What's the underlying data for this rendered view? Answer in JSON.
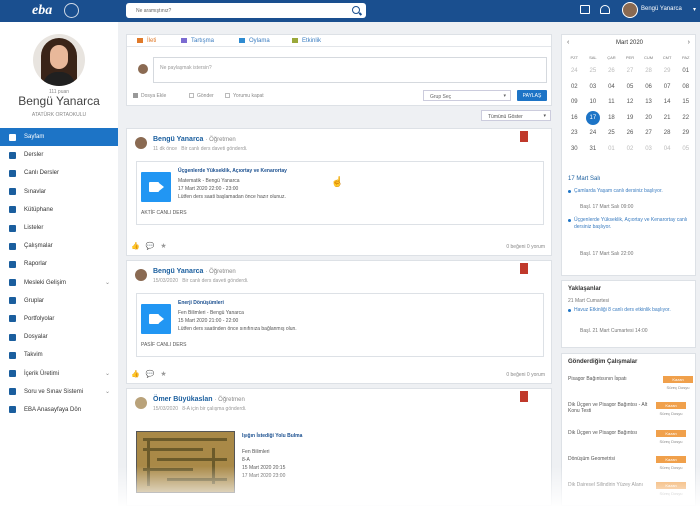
{
  "header": {
    "logo": "eba",
    "search_placeholder": "Ne aramıştınız?",
    "user_name": "Bengü Yanarca"
  },
  "profile": {
    "points": "111 puan",
    "name": "Bengü Yanarca",
    "school": "ATATÜRK ORTAOKULU"
  },
  "nav": [
    {
      "label": "Sayfam",
      "icon": "home-icon"
    },
    {
      "label": "Dersler",
      "icon": "gear-icon"
    },
    {
      "label": "Canlı Dersler",
      "icon": "video-icon"
    },
    {
      "label": "Sınavlar",
      "icon": "pencil-icon"
    },
    {
      "label": "Kütüphane",
      "icon": "book-icon"
    },
    {
      "label": "Listeler",
      "icon": "list-icon"
    },
    {
      "label": "Çalışmalar",
      "icon": "users-icon"
    },
    {
      "label": "Raporlar",
      "icon": "chart-icon"
    },
    {
      "label": "Mesleki Gelişim",
      "icon": "graduation-icon",
      "caret": true
    },
    {
      "label": "Gruplar",
      "icon": "group-icon"
    },
    {
      "label": "Portfolyolar",
      "icon": "folder-icon"
    },
    {
      "label": "Dosyalar",
      "icon": "file-icon"
    },
    {
      "label": "Takvim",
      "icon": "calendar-icon"
    },
    {
      "label": "İçerik Üretimi",
      "icon": "content-icon",
      "caret": true
    },
    {
      "label": "Soru ve Sınav Sistemi",
      "icon": "question-icon",
      "caret": true
    },
    {
      "label": "EBA Anasayfaya Dön",
      "icon": "back-icon"
    }
  ],
  "composer": {
    "tabs": [
      "İleti",
      "Tartışma",
      "Oylama",
      "Etkinlik"
    ],
    "placeholder": "Ne paylaşmak istersin?",
    "options": [
      "Dosya Ekle",
      "Gönder",
      "Yorumu kapat"
    ],
    "group_select": "Grup Seç",
    "share_button": "PAYLAŞ"
  },
  "filter": "Tümünü Göster",
  "posts": [
    {
      "name": "Bengü Yanarca",
      "role": "· Öğretmen",
      "time": "11 dk önce",
      "action": "Bir canlı ders daveti gönderdi.",
      "card_title": "Üçgenlerde Yükseklik, Açıortay ve Kenarortay",
      "lines": [
        "Matematik - Bengü Yanarca",
        "17 Mart 2020 22:00 - 23:00",
        "Lütfen ders saati başlamadan önce hazır olunuz."
      ],
      "status": "AKTİF CANLI DERS",
      "stats": "0 beğeni   0 yorum"
    },
    {
      "name": "Bengü Yanarca",
      "role": "· Öğretmen",
      "time": "15/03/2020",
      "action": "Bir canlı ders daveti gönderdi.",
      "card_title": "Enerji Dönüşümleri",
      "lines": [
        "Fen Bilimleri - Bengü Yanarca",
        "15 Mart 2020 21:00 - 22:00",
        "Lütfen ders saatinden önce sınıfınıza bağlanmış olun."
      ],
      "status": "PASİF CANLI DERS",
      "stats": "0 beğeni   0 yorum"
    },
    {
      "name": "Ömer Büyükaslan",
      "role": "· Öğretmen",
      "time": "15/03/2020",
      "action": "8-A için bir çalışma gönderdi.",
      "card_title": "Işığın İstediği Yolu Bulma",
      "lines": [
        "Fen Bilimleri",
        "8-A",
        "15 Mart 2020 20:15",
        "17 Mart 2020 23:00"
      ]
    }
  ],
  "calendar": {
    "month": "Mart 2020",
    "days_of_week": [
      "PZT",
      "SAL",
      "ÇAR",
      "PER",
      "CUM",
      "CMT",
      "PAZ"
    ],
    "weeks": [
      [
        "24",
        "25",
        "26",
        "27",
        "28",
        "29",
        "01"
      ],
      [
        "02",
        "03",
        "04",
        "05",
        "06",
        "07",
        "08"
      ],
      [
        "09",
        "10",
        "11",
        "12",
        "13",
        "14",
        "15"
      ],
      [
        "16",
        "17",
        "18",
        "19",
        "20",
        "21",
        "22"
      ],
      [
        "23",
        "24",
        "25",
        "26",
        "27",
        "28",
        "29"
      ],
      [
        "30",
        "31",
        "01",
        "02",
        "03",
        "04",
        "05"
      ]
    ],
    "selected_date": "17 Mart Salı",
    "events": [
      {
        "title": "Çamlarda Yaşam canlı dersiniz başlıyor.",
        "time": "Başl. 17 Mart Salı 09:00"
      },
      {
        "title": "Üçgenlerde Yükseklik, Açıortay ve Kenarortay canlı dersiniz başlıyor.",
        "time": "Başl. 17 Mart Salı 22:00"
      }
    ],
    "upcoming_title": "Yaklaşanlar",
    "upcoming_date": "21 Mart Cumartesi",
    "upcoming_event": {
      "title": "Havuz Etkinliği 8 canlı ders etkinlik başlıyor.",
      "time": "Başl. 21 Mart Cumartesi 14:00"
    }
  },
  "sent_works": {
    "title": "Gönderdiğim Çalışmalar",
    "items": [
      {
        "title": "Pisagor Bağıntısının İspatı",
        "badge": "Kazan",
        "link": "Süreç Dosyu"
      },
      {
        "title": "Dik Üçgen ve Pisagor Bağıntısı - Alt Konu Testi",
        "badge": "Kazan",
        "link": "Süreç Dosyu"
      },
      {
        "title": "Dik Üçgen ve Pisagor Bağıntısı",
        "badge": "Kazan",
        "link": "Süreç Dosyu"
      },
      {
        "title": "Dönüşüm Geometrisi",
        "badge": "Kazan",
        "link": "Süreç Dosyu"
      },
      {
        "title": "Dik Dairesel Silindirin Yüzey Alanı",
        "badge": "Kazan",
        "link": "Süreç Dosyu"
      }
    ]
  }
}
